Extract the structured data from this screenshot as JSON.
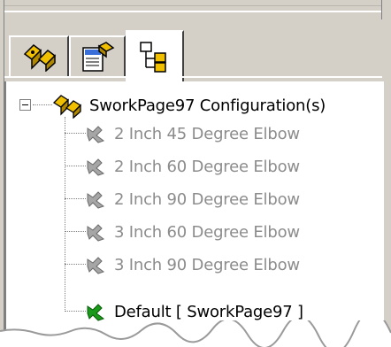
{
  "tabs": [
    {
      "id": "feature-manager",
      "icon": "feature-manager-icon"
    },
    {
      "id": "property-manager",
      "icon": "property-manager-icon"
    },
    {
      "id": "configuration-manager",
      "icon": "configuration-manager-icon",
      "active": true
    }
  ],
  "tree": {
    "root_label": "SworkPage97 Configuration(s)",
    "items": [
      {
        "label": "2 Inch 45 Degree Elbow",
        "active": false
      },
      {
        "label": "2 Inch 60 Degree Elbow",
        "active": false
      },
      {
        "label": "2 Inch 90 Degree Elbow",
        "active": false
      },
      {
        "label": "3 Inch 60 Degree Elbow",
        "active": false
      },
      {
        "label": "3 Inch 90 Degree Elbow",
        "active": false
      },
      {
        "label": "Default [ SworkPage97 ]",
        "active": true
      }
    ]
  },
  "colors": {
    "panel_bg": "#d4d0c8",
    "inactive_text": "#8c8c8c",
    "active_config_green": "#1a9a1a",
    "inactive_config_gray": "#8c8c8c",
    "config_icon_yellow": "#f0c000"
  }
}
